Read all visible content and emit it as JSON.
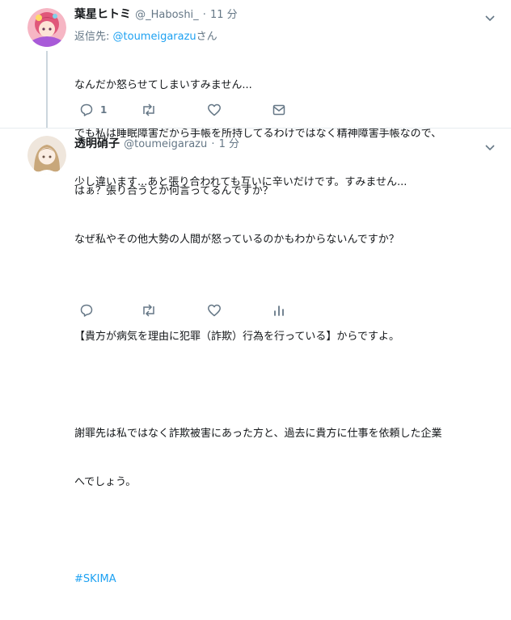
{
  "tweet1": {
    "display_name": "葉星ヒトミ",
    "handle": "@_Haboshi_",
    "dot": "·",
    "time": "11 分",
    "reply_prefix": "返信先: ",
    "reply_handle": "@toumeigarazu",
    "reply_suffix": "さん",
    "lines": [
      "なんだか怒らせてしまいすみません...",
      "でも私は睡眠障害だから手帳を所持してるわけではなく精神障害手帳なので、",
      "少し違います...あと張り合われても互いに辛いだけです。すみません..."
    ],
    "reply_count": "1",
    "icons": [
      "reply-icon",
      "retweet-icon",
      "like-icon",
      "dm-icon",
      "chevron-down-icon"
    ]
  },
  "tweet2": {
    "display_name": "透明硝子",
    "handle": "@toumeigarazu",
    "dot": "·",
    "time": "1 分",
    "lines": [
      "はぁ？張り合うとか何言ってるんですか？",
      "なぜ私やその他大勢の人間が怒っているのかもわからないんですか？",
      "",
      "【貴方が病気を理由に犯罪（詐欺）行為を行っている】からですよ。",
      "",
      "謝罪先は私ではなく詐欺被害にあった方と、過去に貴方に仕事を依頼した企業",
      "へでしょう。",
      ""
    ],
    "hashtag": "#SKIMA",
    "icons": [
      "reply-icon",
      "retweet-icon",
      "like-icon",
      "analytics-icon",
      "chevron-down-icon"
    ]
  },
  "colors": {
    "link": "#1da1f2",
    "meta": "#657786",
    "text": "#14171a",
    "thread_line": "#ccd6dd"
  }
}
